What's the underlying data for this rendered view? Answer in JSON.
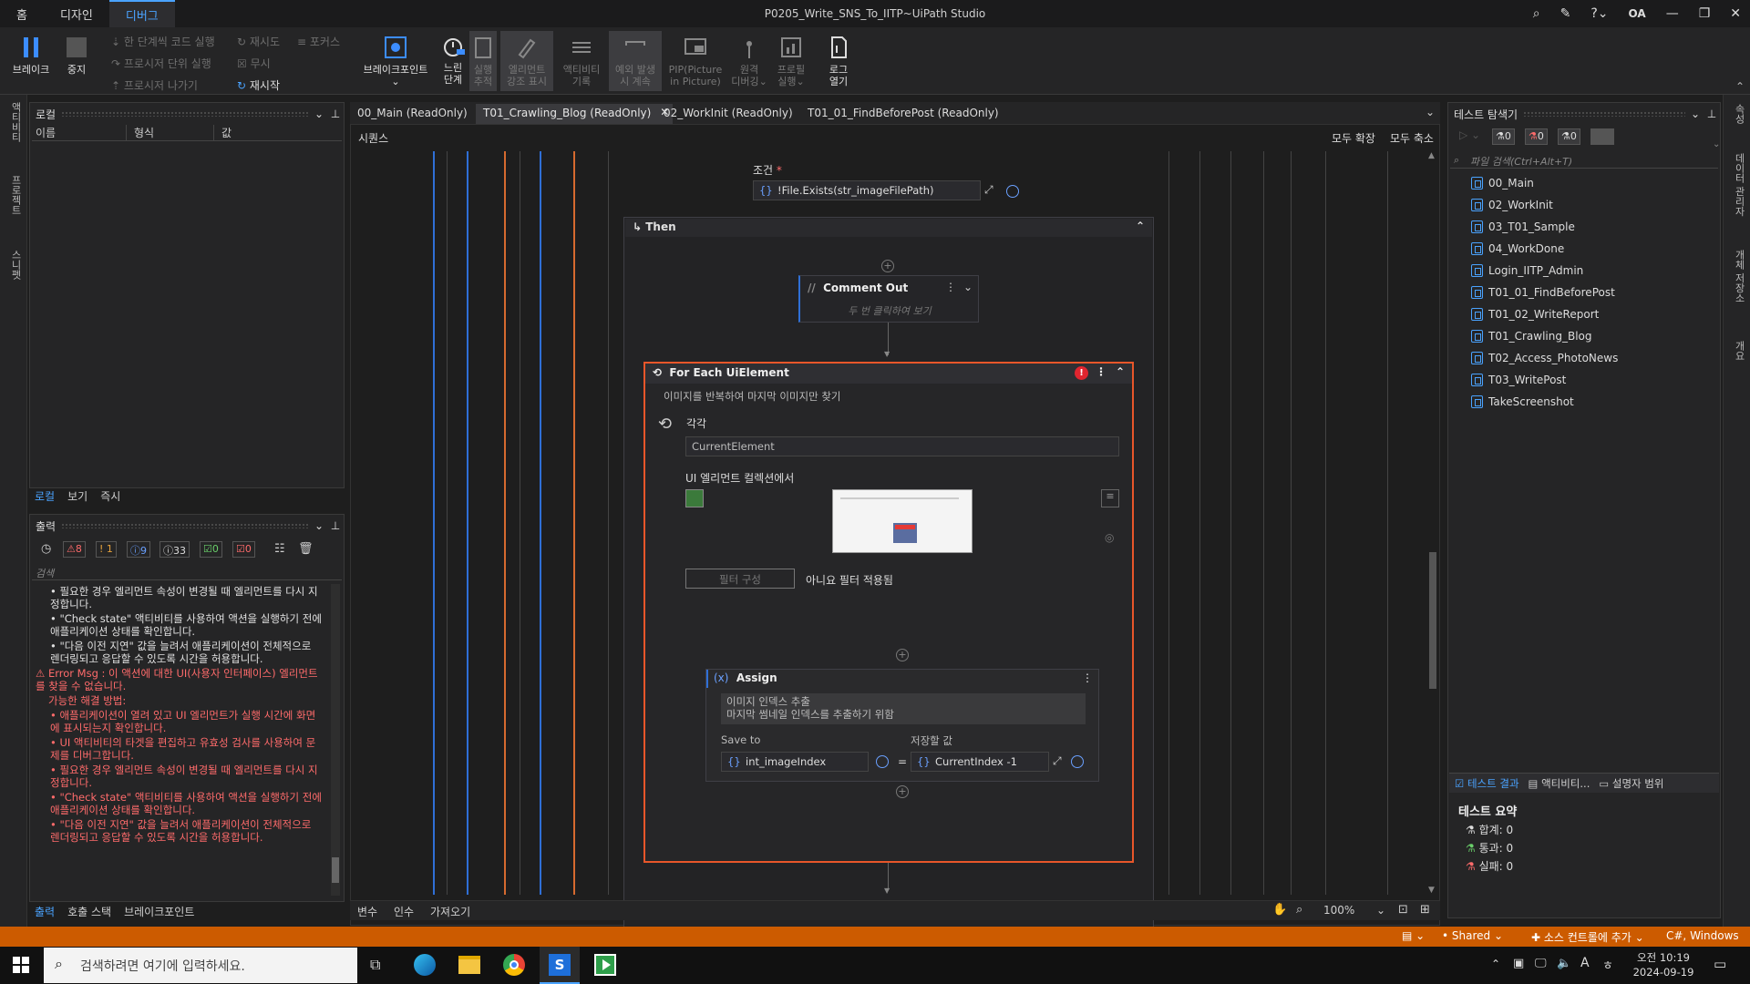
{
  "titlebar": {
    "tabs": [
      "홈",
      "디자인",
      "디버그"
    ],
    "active_tab": "디버그",
    "title": "P0205_Write_SNS_To_IITP~UiPath Studio",
    "user": "OA"
  },
  "ribbon": {
    "break": "브레이크",
    "stop": "중지",
    "step_into": "한 단계씩 코드 실행",
    "step_over": "프로시저 단위 실행",
    "step_out": "프로시저 나가기",
    "retry": "재시도",
    "focus": "포커스",
    "ignore": "무시",
    "restart": "재시작",
    "breakpoints": "브레이크포인트",
    "slow_step_1": "느린",
    "slow_step_2": "단계",
    "run_step_1": "실행",
    "run_step_2": "추적",
    "highlight_1": "엘리먼트",
    "highlight_2": "강조 표시",
    "log_activity_1": "액티비티",
    "log_activity_2": "기록",
    "continue_on_exc_1": "예외 발생",
    "continue_on_exc_2": "시 계속",
    "pip_1": "PIP(Picture",
    "pip_2": "in Picture)",
    "remote_1": "원격",
    "remote_2": "디버깅",
    "profile_1": "프로필",
    "profile_2": "실행",
    "open_logs_1": "로그",
    "open_logs_2": "열기"
  },
  "left_sidebar": [
    "액티비티",
    "프로젝트",
    "스니펫"
  ],
  "locals_panel": {
    "title": "로컬",
    "columns": [
      "이름",
      "형식",
      "값"
    ],
    "tabs": [
      "로컬",
      "보기",
      "즉시"
    ]
  },
  "output_panel": {
    "title": "출력",
    "counts": {
      "err": "8",
      "warn": "1",
      "info": "9",
      "trace": "33",
      "ok": "0",
      "fail": "0"
    },
    "search_placeholder": "검색",
    "lines": [
      {
        "type": "info",
        "text": "• 필요한 경우 엘리먼트 속성이 변경될 때 엘리먼트를 다시 지정합니다."
      },
      {
        "type": "info",
        "text": "• \"Check state\" 액티비티를 사용하여 액션을 실행하기 전에 애플리케이션 상태를 확인합니다."
      },
      {
        "type": "info",
        "text": "• \"다음 이전 지연\" 값을 늘려서 애플리케이션이 전체적으로 렌더링되고 응답할 수 있도록 시간을 허용합니다."
      },
      {
        "type": "err",
        "text": "⚠ Error Msg : 이 액션에 대한 UI(사용자 인터페이스) 엘리먼트를 찾을 수 없습니다."
      },
      {
        "type": "err",
        "text": "가능한 해결 방법:"
      },
      {
        "type": "err",
        "text": "• 애플리케이션이 열려 있고 UI 엘리먼트가 실행 시간에 화면에 표시되는지 확인합니다."
      },
      {
        "type": "err",
        "text": "• UI 액티비티의 타겟을 편집하고 유효성 검사를 사용하여 문제를 디버그합니다."
      },
      {
        "type": "err",
        "text": "• 필요한 경우 엘리먼트 속성이 변경될 때 엘리먼트를 다시 지정합니다."
      },
      {
        "type": "err",
        "text": "• \"Check state\" 액티비티를 사용하여 액션을 실행하기 전에 애플리케이션 상태를 확인합니다."
      },
      {
        "type": "err",
        "text": "• \"다음 이전 지연\" 값을 늘려서 애플리케이션이 전체적으로 렌더링되고 응답할 수 있도록 시간을 허용합니다."
      }
    ],
    "bottom_tabs": [
      "출력",
      "호출 스택",
      "브레이크포인트"
    ]
  },
  "doc_tabs": [
    "00_Main (ReadOnly)",
    "T01_Crawling_Blog (ReadOnly)",
    "02_WorkInit (ReadOnly)",
    "T01_01_FindBeforePost (ReadOnly)"
  ],
  "designer": {
    "header": "시퀀스",
    "expand_all": "모두 확장",
    "collapse_all": "모두 축소",
    "condition_label": "조건",
    "condition_required": "*",
    "condition_value": "!File.Exists(str_imageFilePath)",
    "then_label": "Then",
    "comment": {
      "title": "Comment Out",
      "hint": "두 번 클릭하여 보기"
    },
    "foreach": {
      "title": "For Each UiElement",
      "description": "이미지를 반복하여 마지막 이미지만 찾기",
      "each_label": "각각",
      "each_value": "CurrentElement",
      "collection_label": "UI 엘리먼트 컬렉션에서",
      "filter_button": "필터 구성",
      "filter_status": "아니요 필터 적용됨"
    },
    "assign": {
      "title": "Assign",
      "annotation_1": "이미지 인덱스 추출",
      "annotation_2": "마지막 썸네일 인덱스를 추출하기 위함",
      "save_to_label": "Save to",
      "save_value_label": "저장할 값",
      "save_to_value": "int_imageIndex",
      "equals": "=",
      "value": "CurrentIndex -1"
    },
    "bottom_tabs": [
      "변수",
      "인수",
      "가져오기"
    ],
    "zoom": "100%"
  },
  "test_explorer": {
    "title": "테스트 탐색기",
    "counts": [
      "0",
      "0",
      "0"
    ],
    "search_placeholder": "파일 검색(Ctrl+Alt+T)",
    "items": [
      "00_Main",
      "02_WorkInit",
      "03_T01_Sample",
      "04_WorkDone",
      "Login_IITP_Admin",
      "T01_01_FindBeforePost",
      "T01_02_WriteReport",
      "T01_Crawling_Blog",
      "T02_Access_PhotoNews",
      "T03_WritePost",
      "TakeScreenshot"
    ],
    "bottom_tabs": [
      "테스트 결과",
      "액티비티...",
      "설명자 범위"
    ],
    "summary_title": "테스트 요약",
    "summary": {
      "total": "합계: 0",
      "passed": "통과: 0",
      "failed": "실패: 0"
    }
  },
  "right_sidebar": [
    "속성",
    "데이터 관리자",
    "개체 저장소",
    "개요"
  ],
  "statusbar": {
    "shared": "Shared",
    "source_control": "소스 컨트롤에 추가",
    "language": "C#, Windows"
  },
  "taskbar": {
    "search_placeholder": "검색하려면 여기에 입력하세요.",
    "time": "오전 10:19",
    "date": "2024-09-19",
    "lang": "A"
  },
  "colors": {
    "accent": "#4aa3ff",
    "error": "#ff6b6b",
    "foreach_border": "#e8562a",
    "statusbar": "#cc5b00"
  }
}
